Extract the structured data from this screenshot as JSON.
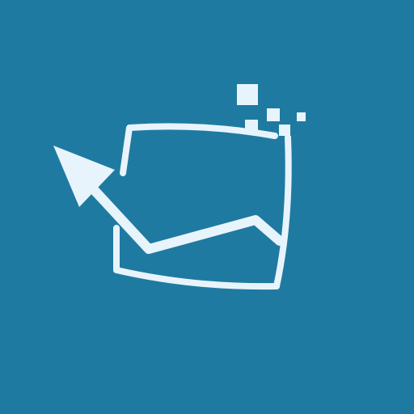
{
  "icon": {
    "semantic_name": "export-chart-arrow-icon",
    "background_color": "#1f7aa1",
    "foreground_color": "#e8f4fb"
  }
}
